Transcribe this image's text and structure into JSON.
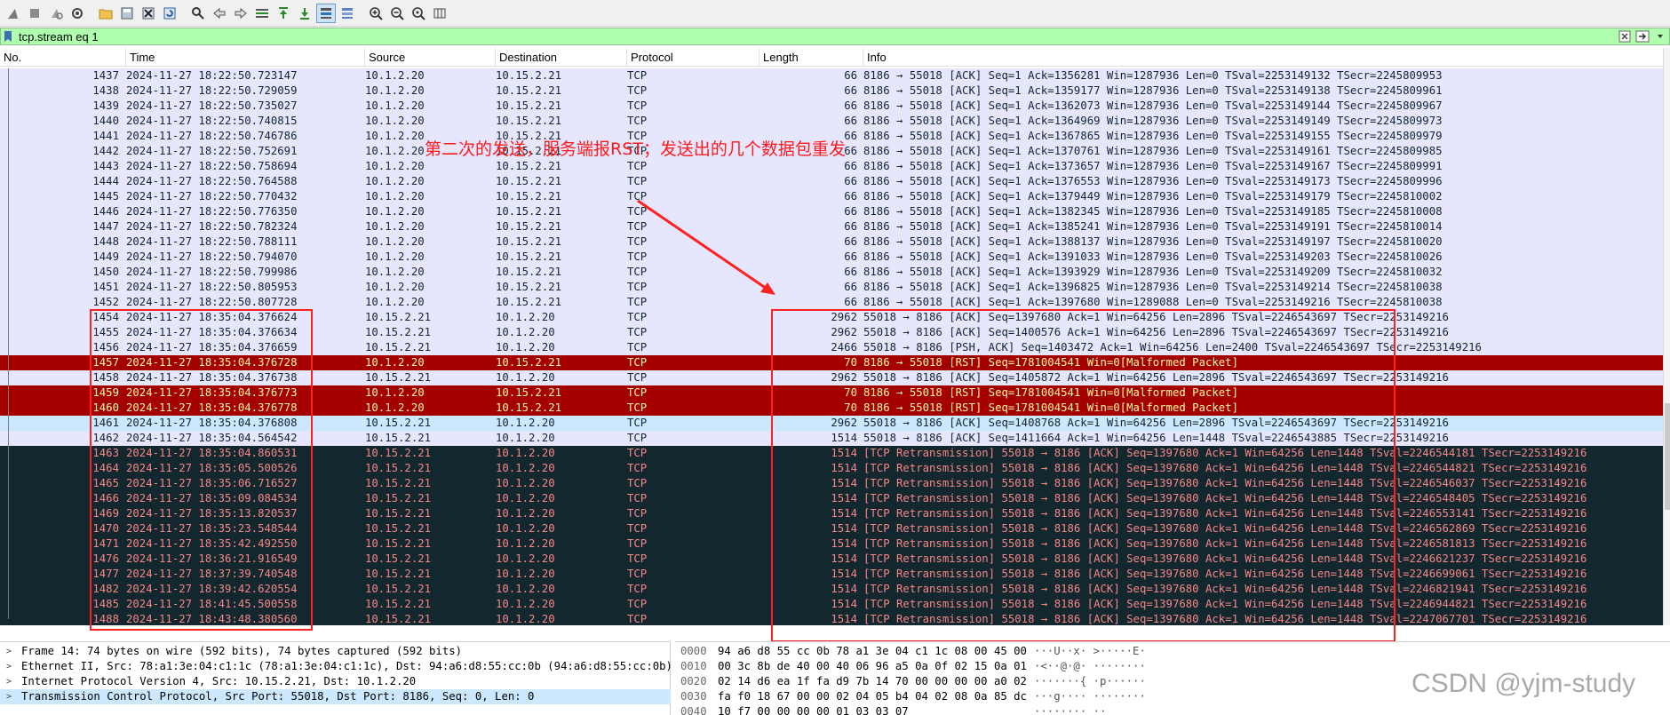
{
  "filter": {
    "value": "tcp.stream eq 1"
  },
  "columns": [
    "No.",
    "Time",
    "Source",
    "Destination",
    "Protocol",
    "Length",
    "Info"
  ],
  "colors": {
    "normal_bg": "#e7e6ff",
    "normal_fg": "#12272e",
    "rst_bg": "#a40000",
    "rst_fg": "#fffc9c",
    "retrans_bg": "#12272e",
    "retrans_fg": "#f78787",
    "selected_bg": "#cce8ff",
    "annotation": "#ff1a1a"
  },
  "packets": [
    {
      "no": "1437",
      "time": "2024-11-27 18:22:50.723147",
      "src": "10.1.2.20",
      "dst": "10.15.2.21",
      "proto": "TCP",
      "len": "66",
      "info": "8186 → 55018 [ACK] Seq=1 Ack=1356281 Win=1287936 Len=0 TSval=2253149132 TSecr=2245809953",
      "style": "normal"
    },
    {
      "no": "1438",
      "time": "2024-11-27 18:22:50.729059",
      "src": "10.1.2.20",
      "dst": "10.15.2.21",
      "proto": "TCP",
      "len": "66",
      "info": "8186 → 55018 [ACK] Seq=1 Ack=1359177 Win=1287936 Len=0 TSval=2253149138 TSecr=2245809961",
      "style": "normal"
    },
    {
      "no": "1439",
      "time": "2024-11-27 18:22:50.735027",
      "src": "10.1.2.20",
      "dst": "10.15.2.21",
      "proto": "TCP",
      "len": "66",
      "info": "8186 → 55018 [ACK] Seq=1 Ack=1362073 Win=1287936 Len=0 TSval=2253149144 TSecr=2245809967",
      "style": "normal"
    },
    {
      "no": "1440",
      "time": "2024-11-27 18:22:50.740815",
      "src": "10.1.2.20",
      "dst": "10.15.2.21",
      "proto": "TCP",
      "len": "66",
      "info": "8186 → 55018 [ACK] Seq=1 Ack=1364969 Win=1287936 Len=0 TSval=2253149149 TSecr=2245809973",
      "style": "normal"
    },
    {
      "no": "1441",
      "time": "2024-11-27 18:22:50.746786",
      "src": "10.1.2.20",
      "dst": "10.15.2.21",
      "proto": "TCP",
      "len": "66",
      "info": "8186 → 55018 [ACK] Seq=1 Ack=1367865 Win=1287936 Len=0 TSval=2253149155 TSecr=2245809979",
      "style": "normal"
    },
    {
      "no": "1442",
      "time": "2024-11-27 18:22:50.752691",
      "src": "10.1.2.20",
      "dst": "10.15.2.21",
      "proto": "TCP",
      "len": "66",
      "info": "8186 → 55018 [ACK] Seq=1 Ack=1370761 Win=1287936 Len=0 TSval=2253149161 TSecr=2245809985",
      "style": "normal"
    },
    {
      "no": "1443",
      "time": "2024-11-27 18:22:50.758694",
      "src": "10.1.2.20",
      "dst": "10.15.2.21",
      "proto": "TCP",
      "len": "66",
      "info": "8186 → 55018 [ACK] Seq=1 Ack=1373657 Win=1287936 Len=0 TSval=2253149167 TSecr=2245809991",
      "style": "normal"
    },
    {
      "no": "1444",
      "time": "2024-11-27 18:22:50.764588",
      "src": "10.1.2.20",
      "dst": "10.15.2.21",
      "proto": "TCP",
      "len": "66",
      "info": "8186 → 55018 [ACK] Seq=1 Ack=1376553 Win=1287936 Len=0 TSval=2253149173 TSecr=2245809996",
      "style": "normal"
    },
    {
      "no": "1445",
      "time": "2024-11-27 18:22:50.770432",
      "src": "10.1.2.20",
      "dst": "10.15.2.21",
      "proto": "TCP",
      "len": "66",
      "info": "8186 → 55018 [ACK] Seq=1 Ack=1379449 Win=1287936 Len=0 TSval=2253149179 TSecr=2245810002",
      "style": "normal"
    },
    {
      "no": "1446",
      "time": "2024-11-27 18:22:50.776350",
      "src": "10.1.2.20",
      "dst": "10.15.2.21",
      "proto": "TCP",
      "len": "66",
      "info": "8186 → 55018 [ACK] Seq=1 Ack=1382345 Win=1287936 Len=0 TSval=2253149185 TSecr=2245810008",
      "style": "normal"
    },
    {
      "no": "1447",
      "time": "2024-11-27 18:22:50.782324",
      "src": "10.1.2.20",
      "dst": "10.15.2.21",
      "proto": "TCP",
      "len": "66",
      "info": "8186 → 55018 [ACK] Seq=1 Ack=1385241 Win=1287936 Len=0 TSval=2253149191 TSecr=2245810014",
      "style": "normal"
    },
    {
      "no": "1448",
      "time": "2024-11-27 18:22:50.788111",
      "src": "10.1.2.20",
      "dst": "10.15.2.21",
      "proto": "TCP",
      "len": "66",
      "info": "8186 → 55018 [ACK] Seq=1 Ack=1388137 Win=1287936 Len=0 TSval=2253149197 TSecr=2245810020",
      "style": "normal"
    },
    {
      "no": "1449",
      "time": "2024-11-27 18:22:50.794070",
      "src": "10.1.2.20",
      "dst": "10.15.2.21",
      "proto": "TCP",
      "len": "66",
      "info": "8186 → 55018 [ACK] Seq=1 Ack=1391033 Win=1287936 Len=0 TSval=2253149203 TSecr=2245810026",
      "style": "normal"
    },
    {
      "no": "1450",
      "time": "2024-11-27 18:22:50.799986",
      "src": "10.1.2.20",
      "dst": "10.15.2.21",
      "proto": "TCP",
      "len": "66",
      "info": "8186 → 55018 [ACK] Seq=1 Ack=1393929 Win=1287936 Len=0 TSval=2253149209 TSecr=2245810032",
      "style": "normal"
    },
    {
      "no": "1451",
      "time": "2024-11-27 18:22:50.805953",
      "src": "10.1.2.20",
      "dst": "10.15.2.21",
      "proto": "TCP",
      "len": "66",
      "info": "8186 → 55018 [ACK] Seq=1 Ack=1396825 Win=1287936 Len=0 TSval=2253149214 TSecr=2245810038",
      "style": "normal"
    },
    {
      "no": "1452",
      "time": "2024-11-27 18:22:50.807728",
      "src": "10.1.2.20",
      "dst": "10.15.2.21",
      "proto": "TCP",
      "len": "66",
      "info": "8186 → 55018 [ACK] Seq=1 Ack=1397680 Win=1289088 Len=0 TSval=2253149216 TSecr=2245810038",
      "style": "normal"
    },
    {
      "no": "1454",
      "time": "2024-11-27 18:35:04.376624",
      "src": "10.15.2.21",
      "dst": "10.1.2.20",
      "proto": "TCP",
      "len": "2962",
      "info": "55018 → 8186 [ACK] Seq=1397680 Ack=1 Win=64256 Len=2896 TSval=2246543697 TSecr=2253149216",
      "style": "normal"
    },
    {
      "no": "1455",
      "time": "2024-11-27 18:35:04.376634",
      "src": "10.15.2.21",
      "dst": "10.1.2.20",
      "proto": "TCP",
      "len": "2962",
      "info": "55018 → 8186 [ACK] Seq=1400576 Ack=1 Win=64256 Len=2896 TSval=2246543697 TSecr=2253149216",
      "style": "normal"
    },
    {
      "no": "1456",
      "time": "2024-11-27 18:35:04.376659",
      "src": "10.15.2.21",
      "dst": "10.1.2.20",
      "proto": "TCP",
      "len": "2466",
      "info": "55018 → 8186 [PSH, ACK] Seq=1403472 Ack=1 Win=64256 Len=2400 TSval=2246543697 TSecr=2253149216",
      "style": "normal"
    },
    {
      "no": "1457",
      "time": "2024-11-27 18:35:04.376728",
      "src": "10.1.2.20",
      "dst": "10.15.2.21",
      "proto": "TCP",
      "len": "70",
      "info": "8186 → 55018 [RST] Seq=1781004541 Win=0[Malformed Packet]",
      "style": "rst"
    },
    {
      "no": "1458",
      "time": "2024-11-27 18:35:04.376738",
      "src": "10.15.2.21",
      "dst": "10.1.2.20",
      "proto": "TCP",
      "len": "2962",
      "info": "55018 → 8186 [ACK] Seq=1405872 Ack=1 Win=64256 Len=2896 TSval=2246543697 TSecr=2253149216",
      "style": "normal"
    },
    {
      "no": "1459",
      "time": "2024-11-27 18:35:04.376773",
      "src": "10.1.2.20",
      "dst": "10.15.2.21",
      "proto": "TCP",
      "len": "70",
      "info": "8186 → 55018 [RST] Seq=1781004541 Win=0[Malformed Packet]",
      "style": "rst"
    },
    {
      "no": "1460",
      "time": "2024-11-27 18:35:04.376778",
      "src": "10.1.2.20",
      "dst": "10.15.2.21",
      "proto": "TCP",
      "len": "70",
      "info": "8186 → 55018 [RST] Seq=1781004541 Win=0[Malformed Packet]",
      "style": "rst"
    },
    {
      "no": "1461",
      "time": "2024-11-27 18:35:04.376808",
      "src": "10.15.2.21",
      "dst": "10.1.2.20",
      "proto": "TCP",
      "len": "2962",
      "info": "55018 → 8186 [ACK] Seq=1408768 Ack=1 Win=64256 Len=2896 TSval=2246543697 TSecr=2253149216",
      "style": "selected"
    },
    {
      "no": "1462",
      "time": "2024-11-27 18:35:04.564542",
      "src": "10.15.2.21",
      "dst": "10.1.2.20",
      "proto": "TCP",
      "len": "1514",
      "info": "55018 → 8186 [ACK] Seq=1411664 Ack=1 Win=64256 Len=1448 TSval=2246543885 TSecr=2253149216",
      "style": "normal"
    },
    {
      "no": "1463",
      "time": "2024-11-27 18:35:04.860531",
      "src": "10.15.2.21",
      "dst": "10.1.2.20",
      "proto": "TCP",
      "len": "1514",
      "info": "[TCP Retransmission] 55018 → 8186 [ACK] Seq=1397680 Ack=1 Win=64256 Len=1448 TSval=2246544181 TSecr=2253149216",
      "style": "retrans"
    },
    {
      "no": "1464",
      "time": "2024-11-27 18:35:05.500526",
      "src": "10.15.2.21",
      "dst": "10.1.2.20",
      "proto": "TCP",
      "len": "1514",
      "info": "[TCP Retransmission] 55018 → 8186 [ACK] Seq=1397680 Ack=1 Win=64256 Len=1448 TSval=2246544821 TSecr=2253149216",
      "style": "retrans"
    },
    {
      "no": "1465",
      "time": "2024-11-27 18:35:06.716527",
      "src": "10.15.2.21",
      "dst": "10.1.2.20",
      "proto": "TCP",
      "len": "1514",
      "info": "[TCP Retransmission] 55018 → 8186 [ACK] Seq=1397680 Ack=1 Win=64256 Len=1448 TSval=2246546037 TSecr=2253149216",
      "style": "retrans"
    },
    {
      "no": "1466",
      "time": "2024-11-27 18:35:09.084534",
      "src": "10.15.2.21",
      "dst": "10.1.2.20",
      "proto": "TCP",
      "len": "1514",
      "info": "[TCP Retransmission] 55018 → 8186 [ACK] Seq=1397680 Ack=1 Win=64256 Len=1448 TSval=2246548405 TSecr=2253149216",
      "style": "retrans"
    },
    {
      "no": "1469",
      "time": "2024-11-27 18:35:13.820537",
      "src": "10.15.2.21",
      "dst": "10.1.2.20",
      "proto": "TCP",
      "len": "1514",
      "info": "[TCP Retransmission] 55018 → 8186 [ACK] Seq=1397680 Ack=1 Win=64256 Len=1448 TSval=2246553141 TSecr=2253149216",
      "style": "retrans"
    },
    {
      "no": "1470",
      "time": "2024-11-27 18:35:23.548544",
      "src": "10.15.2.21",
      "dst": "10.1.2.20",
      "proto": "TCP",
      "len": "1514",
      "info": "[TCP Retransmission] 55018 → 8186 [ACK] Seq=1397680 Ack=1 Win=64256 Len=1448 TSval=2246562869 TSecr=2253149216",
      "style": "retrans"
    },
    {
      "no": "1471",
      "time": "2024-11-27 18:35:42.492550",
      "src": "10.15.2.21",
      "dst": "10.1.2.20",
      "proto": "TCP",
      "len": "1514",
      "info": "[TCP Retransmission] 55018 → 8186 [ACK] Seq=1397680 Ack=1 Win=64256 Len=1448 TSval=2246581813 TSecr=2253149216",
      "style": "retrans"
    },
    {
      "no": "1476",
      "time": "2024-11-27 18:36:21.916549",
      "src": "10.15.2.21",
      "dst": "10.1.2.20",
      "proto": "TCP",
      "len": "1514",
      "info": "[TCP Retransmission] 55018 → 8186 [ACK] Seq=1397680 Ack=1 Win=64256 Len=1448 TSval=2246621237 TSecr=2253149216",
      "style": "retrans"
    },
    {
      "no": "1477",
      "time": "2024-11-27 18:37:39.740548",
      "src": "10.15.2.21",
      "dst": "10.1.2.20",
      "proto": "TCP",
      "len": "1514",
      "info": "[TCP Retransmission] 55018 → 8186 [ACK] Seq=1397680 Ack=1 Win=64256 Len=1448 TSval=2246699061 TSecr=2253149216",
      "style": "retrans"
    },
    {
      "no": "1482",
      "time": "2024-11-27 18:39:42.620554",
      "src": "10.15.2.21",
      "dst": "10.1.2.20",
      "proto": "TCP",
      "len": "1514",
      "info": "[TCP Retransmission] 55018 → 8186 [ACK] Seq=1397680 Ack=1 Win=64256 Len=1448 TSval=2246821941 TSecr=2253149216",
      "style": "retrans"
    },
    {
      "no": "1485",
      "time": "2024-11-27 18:41:45.500558",
      "src": "10.15.2.21",
      "dst": "10.1.2.20",
      "proto": "TCP",
      "len": "1514",
      "info": "[TCP Retransmission] 55018 → 8186 [ACK] Seq=1397680 Ack=1 Win=64256 Len=1448 TSval=2246944821 TSecr=2253149216",
      "style": "retrans"
    },
    {
      "no": "1488",
      "time": "2024-11-27 18:43:48.380560",
      "src": "10.15.2.21",
      "dst": "10.1.2.20",
      "proto": "TCP",
      "len": "1514",
      "info": "[TCP Retransmission] 55018 → 8186 [ACK] Seq=1397680 Ack=1 Win=64256 Len=1448 TSval=2247067701 TSecr=2253149216",
      "style": "retrans"
    }
  ],
  "annotation": {
    "text": "第二次的发送，服务端报RST；发送出的几个数据包重发"
  },
  "details": [
    {
      "text": "Frame 14: 74 bytes on wire (592 bits), 74 bytes captured (592 bits)",
      "selected": false
    },
    {
      "text": "Ethernet II, Src: 78:a1:3e:04:c1:1c (78:a1:3e:04:c1:1c), Dst: 94:a6:d8:55:cc:0b (94:a6:d8:55:cc:0b)",
      "selected": false
    },
    {
      "text": "Internet Protocol Version 4, Src: 10.15.2.21, Dst: 10.1.2.20",
      "selected": false
    },
    {
      "text": "Transmission Control Protocol, Src Port: 55018, Dst Port: 8186, Seq: 0, Len: 0",
      "selected": true
    }
  ],
  "bytes": [
    {
      "offset": "0000",
      "hex": "94 a6 d8 55 cc 0b 78 a1  3e 04 c1 1c 08 00 45 00",
      "ascii": "···U··x· >·····E·"
    },
    {
      "offset": "0010",
      "hex": "00 3c 8b de 40 00 40 06  96 a5 0a 0f 02 15 0a 01",
      "ascii": "·<··@·@· ········"
    },
    {
      "offset": "0020",
      "hex": "02 14 d6 ea 1f fa d9 7b  14 70 00 00 00 00 a0 02",
      "ascii": "·······{ ·p······"
    },
    {
      "offset": "0030",
      "hex": "fa f0 18 67 00 00 02 04  05 b4 04 02 08 0a 85 dc",
      "ascii": "···g···· ········"
    },
    {
      "offset": "0040",
      "hex": "10 f7 00 00 00 00 01 03  03 07",
      "ascii": "········ ··"
    }
  ],
  "watermark": "CSDN @yjm-study"
}
